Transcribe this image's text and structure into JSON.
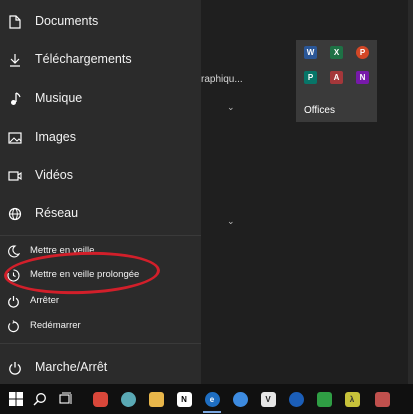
{
  "menu": {
    "folders": [
      {
        "label": "Documents",
        "icon": "document-icon"
      },
      {
        "label": "Téléchargements",
        "icon": "download-icon"
      },
      {
        "label": "Musique",
        "icon": "music-icon"
      },
      {
        "label": "Images",
        "icon": "image-icon"
      },
      {
        "label": "Vidéos",
        "icon": "video-icon"
      },
      {
        "label": "Réseau",
        "icon": "network-icon"
      }
    ],
    "power_options": [
      {
        "label": "Mettre en veille",
        "icon": "moon-icon"
      },
      {
        "label": "Mettre en veille prolongée",
        "icon": "hibernate-clock-icon"
      },
      {
        "label": "Arrêter",
        "icon": "power-icon"
      },
      {
        "label": "Redémarrer",
        "icon": "restart-icon"
      }
    ],
    "power_button": {
      "label": "Marche/Arrêt",
      "icon": "power-icon"
    }
  },
  "background": {
    "fragment_text": "raphiqu...",
    "tile_group": {
      "label": "Offices",
      "apps": [
        {
          "letter": "W",
          "color": "#2b5797",
          "name": "word-icon"
        },
        {
          "letter": "X",
          "color": "#1e7145",
          "name": "excel-icon"
        },
        {
          "letter": "P",
          "color": "#d24726",
          "name": "powerpoint-icon"
        },
        {
          "letter": "P",
          "color": "#077568",
          "name": "publisher-icon"
        },
        {
          "letter": "A",
          "color": "#a4373a",
          "name": "access-icon"
        },
        {
          "letter": "N",
          "color": "#7719aa",
          "name": "onenote-icon"
        }
      ]
    }
  },
  "colors": {
    "panel": "#2b2b2b",
    "highlight_ellipse": "#d21f2a",
    "taskbar": "#101010"
  },
  "taskbar": {
    "icons": [
      "windows-start-icon",
      "search-icon",
      "task-view-icon",
      "app-red-icon",
      "app-globe-icon",
      "app-folder-icon",
      "notion-icon",
      "edge-icon",
      "app-blue-icon",
      "app-vscode-icon",
      "app-circle-icon",
      "app-green-icon",
      "app-yellow-icon",
      "app-monitor-icon"
    ]
  }
}
